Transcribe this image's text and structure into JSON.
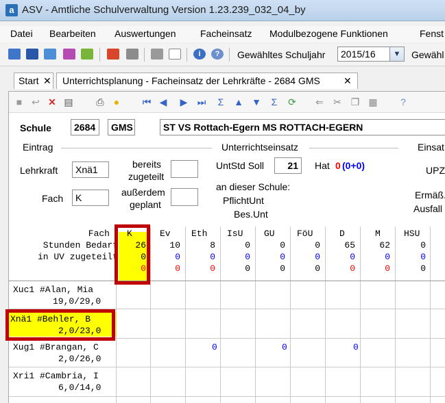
{
  "window": {
    "app_icon": "a",
    "title": "ASV - Amtliche Schulverwaltung Version 1.23.239_032_04_by"
  },
  "menu": [
    {
      "label": "Datei"
    },
    {
      "label": "Bearbeiten"
    },
    {
      "label": "Auswertungen"
    },
    {
      "label": "Facheinsatz"
    },
    {
      "label": "Modulbezogene Funktionen"
    },
    {
      "label": "Fenst"
    }
  ],
  "toolbar": {
    "school_year_label": "Gewähltes Schuljahr",
    "school_year_value": "2015/16",
    "school_label_cut": "Gewähl",
    "icons": [
      "users-icon",
      "teacher-icon",
      "class-icon",
      "group-icon",
      "course-icon",
      "book-icon",
      "calculator-icon",
      "copy-window-icon",
      "window-warning-icon",
      "info-icon",
      "help-icon"
    ]
  },
  "tabs": [
    {
      "label": "Start",
      "close": "✕"
    },
    {
      "label": "Unterrichtsplanung - Facheinsatz der Lehrkräfte - 2684 GMS",
      "close": "✕"
    }
  ],
  "subtoolbar_icons": [
    "save-icon",
    "undo-icon",
    "delete-icon",
    "export-icon",
    "print-icon",
    "hint-bulb-icon",
    "first-icon",
    "previous-icon",
    "next-icon",
    "last-icon",
    "sum-icon",
    "sort-up-icon",
    "sort-down-icon",
    "filter-sum-icon",
    "refresh-icon",
    "back-arrow-icon",
    "cut-icon",
    "copy-icon",
    "paste-icon",
    "help-icon"
  ],
  "school": {
    "label": "Schule",
    "number": "2684",
    "type": "GMS",
    "name": "ST VS Rottach-Egern MS ROTTACH-EGERN"
  },
  "eintrag": {
    "header": "Eintrag",
    "lehrkraft_label": "Lehrkraft",
    "lehrkraft_value": "Xnä1",
    "fach_label": "Fach",
    "fach_value": "K",
    "bereits_line1": "bereits",
    "bereits_line2": "zugeteilt",
    "ausserdem_line1": "außerdem",
    "ausserdem_line2": "geplant",
    "bereits_value": "",
    "ausserdem_value": ""
  },
  "unterrichtseinsatz": {
    "header": "Unterrichtseinsatz",
    "untstd_label": "UntStd Soll",
    "untstd_value": "21",
    "hat_label": "Hat",
    "hat_value_a": "0",
    "hat_value_b": "(0+0)",
    "school_label": "an dieser Schule:",
    "pflicht_label": "PflichtUnt",
    "bes_label": "Bes.Unt"
  },
  "einsatz": {
    "header": "Einsat",
    "upz": "UPZ",
    "ermass": "Ermäß.",
    "ausfall": "Ausfall"
  },
  "grid": {
    "row_labels": [
      "Fach",
      "Stunden Bedarf",
      "in UV zugeteilt",
      ""
    ],
    "subjects": [
      {
        "name": "K",
        "bedarf": "26",
        "zugeteilt": "0",
        "diff": "0"
      },
      {
        "name": "Ev",
        "bedarf": "10",
        "zugeteilt": "0",
        "diff": "0"
      },
      {
        "name": "Eth",
        "bedarf": "8",
        "zugeteilt": "0",
        "diff": "0"
      },
      {
        "name": "IsU",
        "bedarf": "0",
        "zugeteilt": "0",
        "diff": "0"
      },
      {
        "name": "GU",
        "bedarf": "0",
        "zugeteilt": "0",
        "diff": "0"
      },
      {
        "name": "FöU",
        "bedarf": "0",
        "zugeteilt": "0",
        "diff": "0"
      },
      {
        "name": "D",
        "bedarf": "65",
        "zugeteilt": "0",
        "diff": "0"
      },
      {
        "name": "M",
        "bedarf": "62",
        "zugeteilt": "0",
        "diff": "0"
      },
      {
        "name": "HSU",
        "bedarf": "0",
        "zugeteilt": "0",
        "diff": "0"
      }
    ],
    "teachers": [
      {
        "line1": "Xuc1 #Alan, Mia",
        "line2": "19,0/29,0",
        "cells": [
          "",
          "",
          "",
          "",
          "",
          "",
          "",
          "",
          ""
        ]
      },
      {
        "line1": "Xnä1 #Behler, B",
        "line2": "2,0/23,0",
        "cells": [
          "",
          "",
          "",
          "",
          "",
          "",
          "",
          "",
          ""
        ]
      },
      {
        "line1": "Xug1 #Brangan, C",
        "line2": "2,0/26,0",
        "cells": [
          "",
          "",
          "0",
          "",
          "",
          "0",
          "0",
          "",
          ""
        ]
      },
      {
        "line1": "Xri1 #Cambria, I",
        "line2": "6,0/14,0",
        "cells": [
          "",
          "",
          "",
          "",
          "",
          "",
          "",
          "",
          ""
        ]
      }
    ]
  },
  "colors": {
    "highlight": "#ffff00",
    "marker": "#c00000",
    "blue": "#0000ff",
    "red": "#ff0000"
  }
}
